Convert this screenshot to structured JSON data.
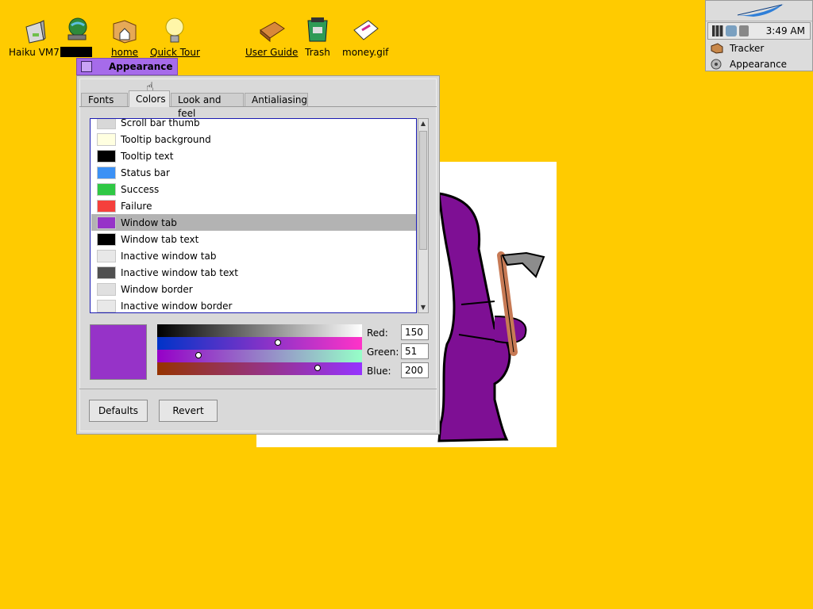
{
  "desktop": {
    "icons": [
      {
        "label": "Haiku VM7",
        "link": false
      },
      {
        "label": "",
        "link": false
      },
      {
        "label": "home",
        "link": true
      },
      {
        "label": "Quick Tour",
        "link": true
      },
      {
        "label": "User Guide",
        "link": true
      },
      {
        "label": "Trash",
        "link": false
      },
      {
        "label": "money.gif",
        "link": false
      }
    ],
    "background_color": "#FFCB00"
  },
  "deskbar": {
    "clock": "3:49 AM",
    "apps": [
      {
        "label": "Tracker",
        "icon": "tracker-icon"
      },
      {
        "label": "Appearance",
        "icon": "appearance-icon"
      }
    ]
  },
  "window": {
    "title": "Appearance",
    "tabs": [
      {
        "label": "Fonts"
      },
      {
        "label": "Colors"
      },
      {
        "label": "Look and feel"
      },
      {
        "label": "Antialiasing"
      }
    ],
    "active_tab": "Colors",
    "color_items": [
      {
        "name": "Scroll bar thumb",
        "color": "#D8D8D8"
      },
      {
        "name": "Tooltip background",
        "color": "#FFFFE0"
      },
      {
        "name": "Tooltip text",
        "color": "#000000"
      },
      {
        "name": "Status bar",
        "color": "#3C91F5"
      },
      {
        "name": "Success",
        "color": "#2FC844"
      },
      {
        "name": "Failure",
        "color": "#F5403C"
      },
      {
        "name": "Window tab",
        "color": "#9633C8"
      },
      {
        "name": "Window tab text",
        "color": "#000000"
      },
      {
        "name": "Inactive window tab",
        "color": "#E8E8E8"
      },
      {
        "name": "Inactive window tab text",
        "color": "#505050"
      },
      {
        "name": "Window border",
        "color": "#E0E0E0"
      },
      {
        "name": "Inactive window border",
        "color": "#E8E8E8"
      }
    ],
    "selected_item": "Window tab",
    "preview_color": "#9633C8",
    "channels": [
      {
        "label": "Red:",
        "value": "150",
        "fraction": 0.588
      },
      {
        "label": "Green:",
        "value": "51",
        "fraction": 0.2
      },
      {
        "label": "Blue:",
        "value": "200",
        "fraction": 0.784
      }
    ],
    "buttons": {
      "defaults": "Defaults",
      "revert": "Revert"
    }
  }
}
